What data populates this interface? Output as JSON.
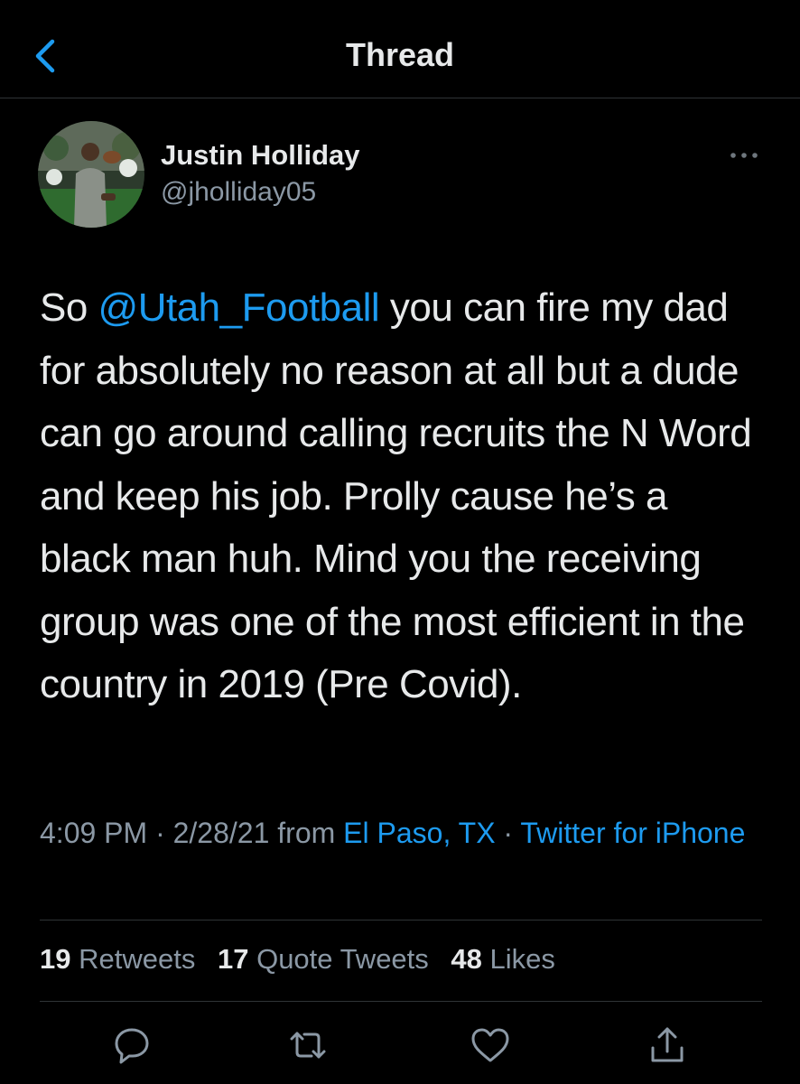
{
  "header": {
    "title": "Thread",
    "back_icon": "chevron-left-icon"
  },
  "author": {
    "name": "Justin Holliday",
    "handle": "@jholliday05"
  },
  "tweet": {
    "text_before": "So ",
    "mention": "@Utah_Football",
    "text_after": " you can fire my dad for absolutely no reason at all but a dude can go around calling recruits the N Word and keep his job. Prolly cause he’s a black man huh. Mind you the receiving group was one of the most efficient in the country in 2019 (Pre Covid)."
  },
  "meta": {
    "time": "4:09 PM",
    "sep1": " · ",
    "date": "2/28/21",
    "from": " from ",
    "location": "El Paso, TX",
    "sep2": " · ",
    "client": "Twitter for iPhone"
  },
  "stats": {
    "retweets_count": "19",
    "retweets_label": "Retweets",
    "quotes_count": "17",
    "quotes_label": "Quote Tweets",
    "likes_count": "48",
    "likes_label": "Likes"
  },
  "actions": [
    "reply-icon",
    "retweet-icon",
    "like-icon",
    "share-icon"
  ],
  "colors": {
    "background": "#000000",
    "accent": "#1d9bf0",
    "secondary_text": "#8b98a5",
    "primary_text": "#e7e9ea",
    "divider": "#2f3336"
  }
}
